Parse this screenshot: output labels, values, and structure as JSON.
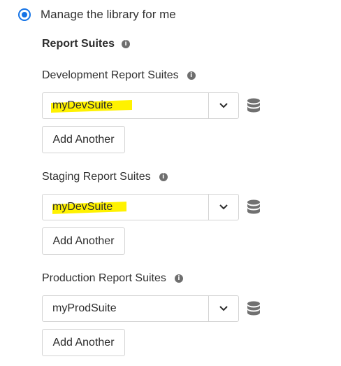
{
  "library_option": {
    "label": "Manage the library for me",
    "selected": true
  },
  "report_suites_title": "Report Suites",
  "groups": [
    {
      "label": "Development Report Suites",
      "value": "myDevSuite",
      "highlighted": true,
      "add_label": "Add Another"
    },
    {
      "label": "Staging Report Suites",
      "value": "myDevSuite",
      "highlighted": true,
      "add_label": "Add Another"
    },
    {
      "label": "Production Report Suites",
      "value": "myProdSuite",
      "highlighted": false,
      "add_label": "Add Another"
    }
  ],
  "icons": {
    "info": "info-icon",
    "dropdown": "chevron-down-icon",
    "database": "database-icon"
  },
  "colors": {
    "accent": "#1473e6",
    "highlight": "#fff200",
    "border": "#d3d3d3"
  }
}
